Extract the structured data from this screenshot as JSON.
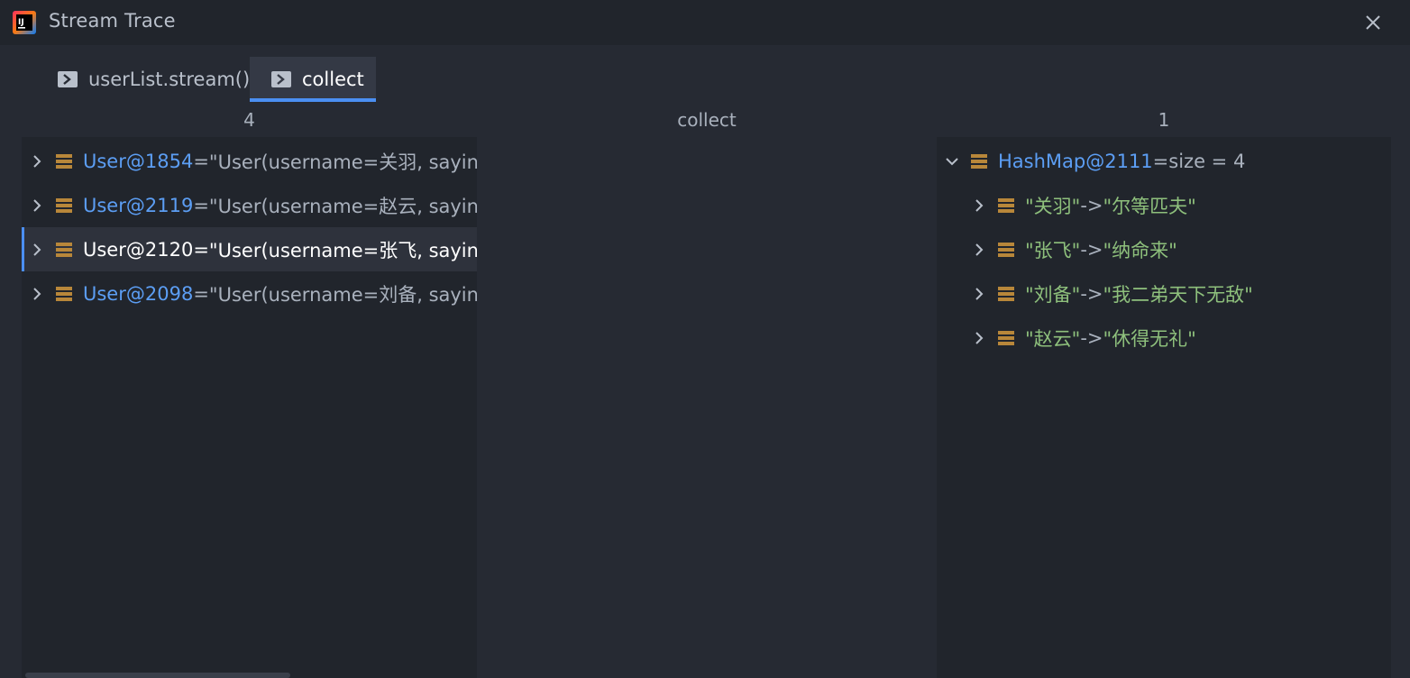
{
  "window": {
    "title": "Stream Trace",
    "logo_icon": "intellij-logo-icon",
    "close_icon": "close-icon"
  },
  "tabs": [
    {
      "label": "userList.stream()",
      "icon": "console-icon",
      "active": false
    },
    {
      "label": "collect",
      "icon": "console-icon",
      "active": true
    }
  ],
  "columns": {
    "left_header": "4",
    "middle_header": "collect",
    "right_header": "1"
  },
  "left_rows": [
    {
      "ref": "User@1854",
      "eq": " = ",
      "value": "\"User(username=关羽, saying",
      "selected": false
    },
    {
      "ref": "User@2119",
      "eq": " = ",
      "value": "\"User(username=赵云, saying",
      "selected": false
    },
    {
      "ref": "User@2120",
      "eq": " = ",
      "value": "\"User(username=张飞, saying",
      "selected": true
    },
    {
      "ref": "User@2098",
      "eq": " = ",
      "value": "\"User(username=刘备, saying",
      "selected": false
    }
  ],
  "right_root": {
    "ref": "HashMap@2111",
    "eq": " = ",
    "value": " size = 4"
  },
  "right_children": [
    {
      "key": "\"关羽\"",
      "arrow": " -> ",
      "value": "\"尔等匹夫\""
    },
    {
      "key": "\"张飞\"",
      "arrow": " -> ",
      "value": "\"纳命来\""
    },
    {
      "key": "\"刘备\"",
      "arrow": " -> ",
      "value": "\"我二弟天下无敌\""
    },
    {
      "key": "\"赵云\"",
      "arrow": " -> ",
      "value": "\"休得无礼\""
    }
  ],
  "colors": {
    "accent": "#4b8ff2",
    "reference": "#5c9ef4",
    "string": "#8ec07c",
    "object_icon": "#b8873a"
  }
}
